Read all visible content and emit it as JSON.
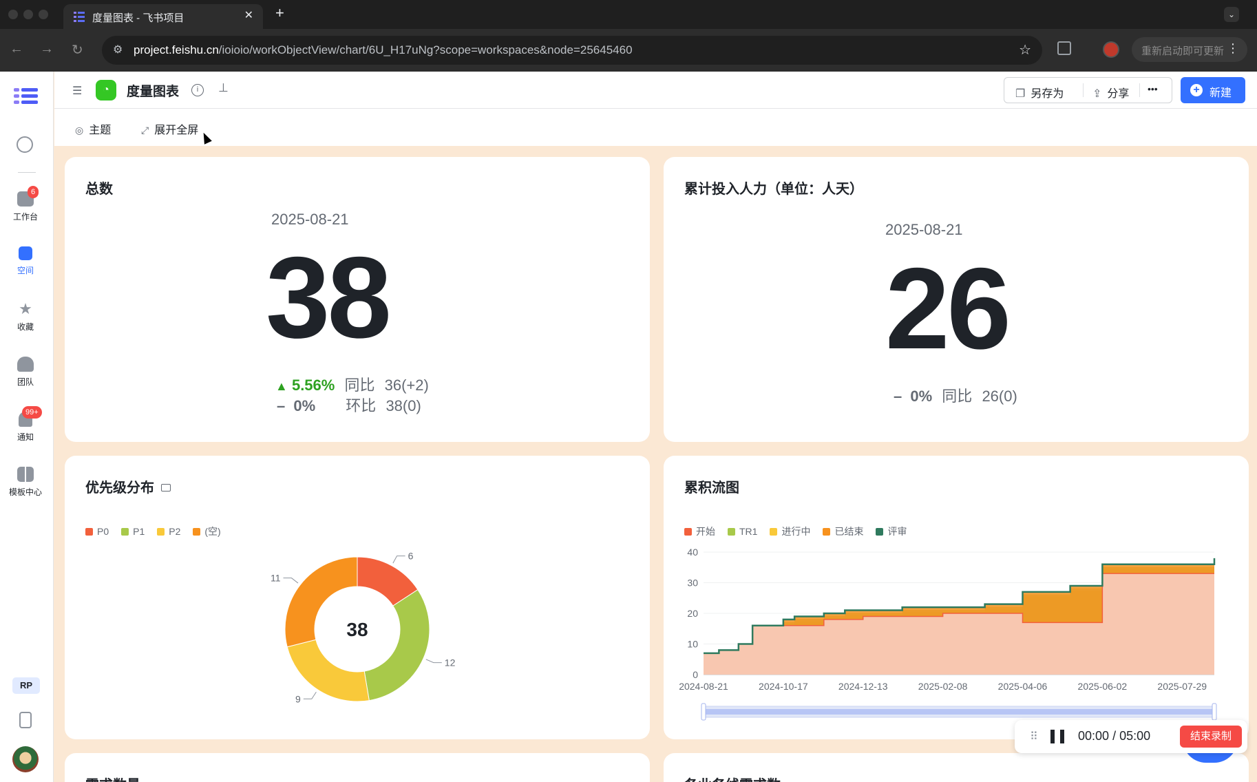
{
  "browser": {
    "tab_title": "度量图表 - 飞书项目",
    "url_host": "project.feishu.cn",
    "url_path": "/ioioio/workObjectView/chart/6U_H17uNg?scope=workspaces&node=25645460",
    "update_label": "重新启动即可更新"
  },
  "sidebar": {
    "items": [
      {
        "label": "工作台",
        "icon": "home-icon",
        "badge": "6"
      },
      {
        "label": "空间",
        "icon": "space-icon"
      },
      {
        "label": "收藏",
        "icon": "star-icon"
      },
      {
        "label": "团队",
        "icon": "team-icon"
      },
      {
        "label": "通知",
        "icon": "bell-icon",
        "badge": "99+"
      },
      {
        "label": "模板中心",
        "icon": "template-icon"
      }
    ],
    "user_badge": "RP"
  },
  "header": {
    "title": "度量图表",
    "save_as": "另存为",
    "share": "分享",
    "more": "•••",
    "new": "新建"
  },
  "toolbar": {
    "theme": "主题",
    "fullscreen": "展开全屏"
  },
  "cards": {
    "total": {
      "title": "总数",
      "date": "2025-08-21",
      "value": "38",
      "yoy_pct": "5.56%",
      "yoy_label": "同比",
      "yoy_value": "36(+2)",
      "mom_pct": "0%",
      "mom_label": "环比",
      "mom_value": "38(0)"
    },
    "effort": {
      "title": "累计投入人力（单位：人天）",
      "date": "2025-08-21",
      "value": "26",
      "yoy_pct": "0%",
      "yoy_label": "同比",
      "yoy_value": "26(0)"
    },
    "priority": {
      "title": "优先级分布",
      "total": "38"
    },
    "cfd": {
      "title": "累积流图"
    },
    "bottom_left_title": "需求数量",
    "bottom_right_title": "各业务线需求数"
  },
  "recording": {
    "elapsed": "00:00",
    "sep": "/",
    "total": "05:00",
    "end_label": "结束录制"
  },
  "colors": {
    "accent": "#3370ff",
    "up": "#2ea121",
    "page_bg": "#fbe8d4"
  },
  "chart_data": [
    {
      "type": "pie",
      "donut": true,
      "center_label": "38",
      "categories": [
        "P0",
        "P1",
        "P2",
        "(空)"
      ],
      "values": [
        6,
        12,
        9,
        11
      ],
      "colors": [
        "#f2603c",
        "#a8c94a",
        "#f9c93a",
        "#f7921e"
      ],
      "legend": "top-left"
    },
    {
      "type": "area",
      "stacked": true,
      "series_names": [
        "开始",
        "TR1",
        "进行中",
        "已结束",
        "评审"
      ],
      "colors": [
        "#f2603c",
        "#a8c94a",
        "#f9c93a",
        "#f7921e",
        "#2f7a5e"
      ],
      "x_ticks": [
        "2024-08-21",
        "2024-10-17",
        "2024-12-13",
        "2025-02-08",
        "2025-04-06",
        "2025-06-02",
        "2025-07-29"
      ],
      "ylim": [
        0,
        40
      ],
      "y_ticks": [
        0,
        10,
        20,
        30,
        40
      ],
      "total_line": {
        "x": [
          "2024-08-21",
          "2024-09-01",
          "2024-09-15",
          "2024-09-25",
          "2024-10-17",
          "2024-10-25",
          "2024-11-15",
          "2024-11-30",
          "2024-12-13",
          "2025-01-10",
          "2025-02-08",
          "2025-03-10",
          "2025-04-06",
          "2025-05-10",
          "2025-06-02",
          "2025-07-29",
          "2025-08-21"
        ],
        "y": [
          7,
          8,
          10,
          16,
          18,
          19,
          20,
          21,
          21,
          22,
          22,
          23,
          27,
          29,
          36,
          36,
          38
        ]
      },
      "start_area": {
        "x": [
          "2024-08-21",
          "2024-09-01",
          "2024-09-15",
          "2024-09-25",
          "2024-10-17",
          "2024-11-15",
          "2024-12-13",
          "2025-02-08",
          "2025-04-06",
          "2025-05-10",
          "2025-06-02",
          "2025-08-21"
        ],
        "y": [
          7,
          8,
          10,
          16,
          16,
          18,
          19,
          20,
          17,
          17,
          33,
          33
        ]
      },
      "legend": "top-left"
    }
  ]
}
